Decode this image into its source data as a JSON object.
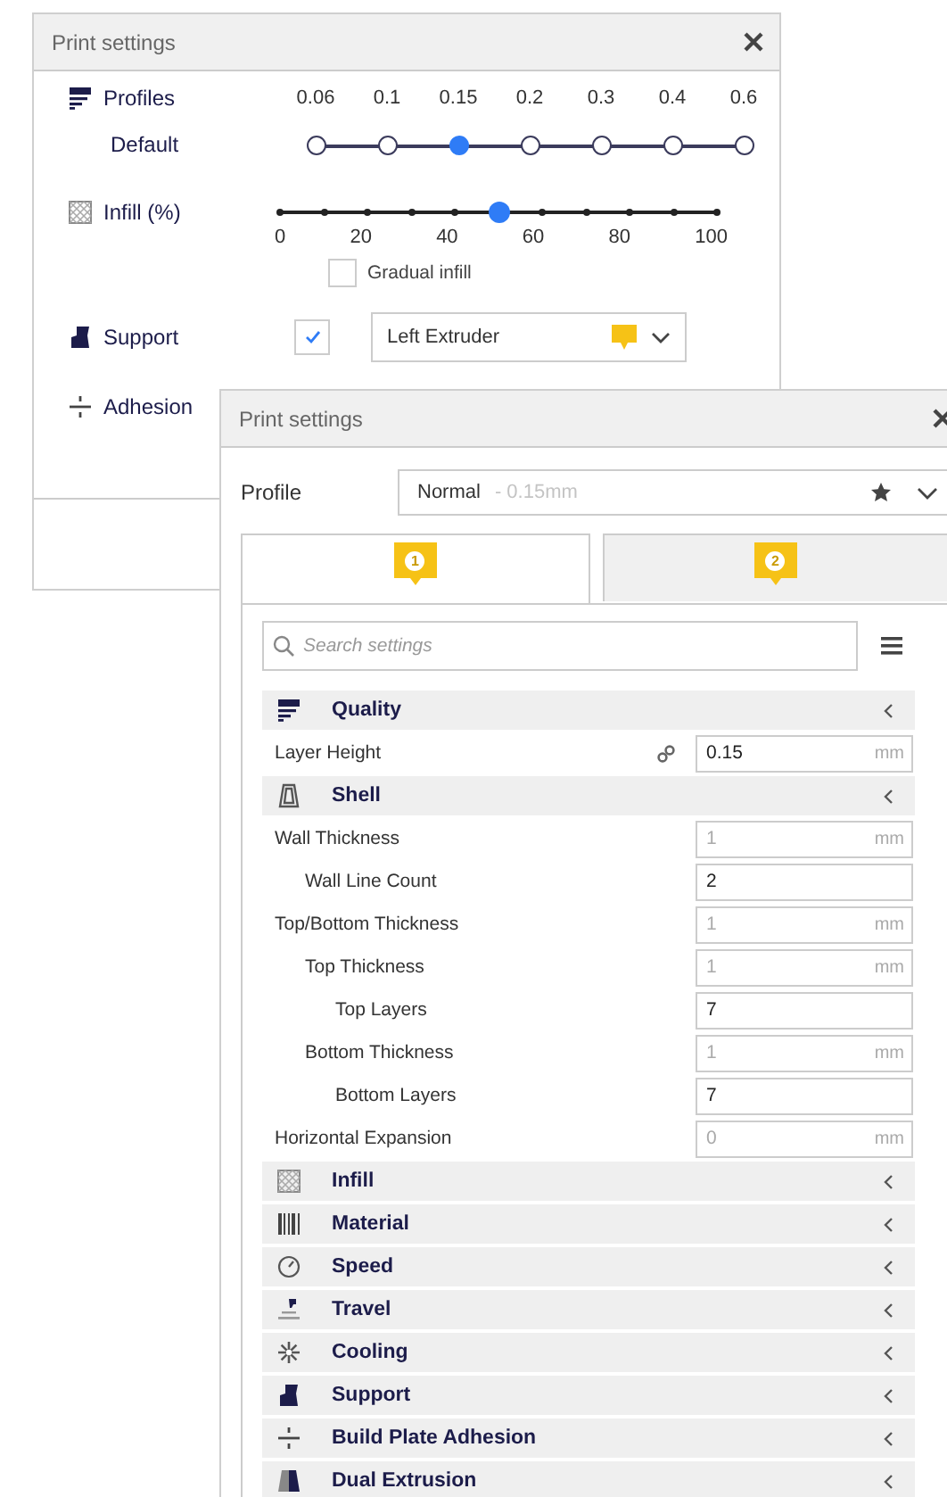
{
  "back_dialog": {
    "title": "Print settings",
    "profiles": {
      "label": "Profiles",
      "sublabel": "Default",
      "options": [
        {
          "label": "0.06",
          "selected": false
        },
        {
          "label": "0.1",
          "selected": false
        },
        {
          "label": "0.15",
          "selected": true
        },
        {
          "label": "0.2",
          "selected": false
        },
        {
          "label": "0.3",
          "selected": false
        },
        {
          "label": "0.4",
          "selected": false
        },
        {
          "label": "0.6",
          "selected": false
        }
      ]
    },
    "infill": {
      "label": "Infill (%)",
      "level": 0.5,
      "ticks": [
        "0",
        "20",
        "40",
        "60",
        "80",
        "100"
      ]
    },
    "gradual_infill": {
      "label": "Gradual infill",
      "checked": false
    },
    "support": {
      "label": "Support",
      "checked": true,
      "extruder": "Left Extruder"
    },
    "adhesion": {
      "label": "Adhesion"
    }
  },
  "front_dialog": {
    "title": "Print settings",
    "profile": {
      "label": "Profile",
      "name": "Normal",
      "detail": "- 0.15mm"
    },
    "extruder_tabs": [
      {
        "label": "1",
        "selected": true
      },
      {
        "label": "2",
        "selected": false
      }
    ],
    "search": {
      "placeholder": "Search settings"
    },
    "categories": [
      {
        "label": "Quality",
        "settings": [
          {
            "label": "Layer Height",
            "value": "0.15",
            "unit": "mm",
            "linked": true,
            "greyed": false
          }
        ]
      },
      {
        "label": "Shell",
        "settings": [
          {
            "label": "Wall Thickness",
            "value": "1",
            "unit": "mm",
            "linked": false,
            "greyed": true,
            "children": [
              {
                "label": "Wall Line Count",
                "value": "2",
                "linked": false,
                "greyed": false
              }
            ]
          },
          {
            "label": "Top/Bottom Thickness",
            "value": "1",
            "unit": "mm",
            "linked": false,
            "greyed": true,
            "children": [
              {
                "label": "Top Thickness",
                "value": "1",
                "unit": "mm",
                "linked": false,
                "greyed": true,
                "children": [
                  {
                    "label": "Top Layers",
                    "value": "7",
                    "linked": false,
                    "greyed": false
                  }
                ]
              },
              {
                "label": "Bottom Thickness",
                "value": "1",
                "unit": "mm",
                "linked": false,
                "greyed": true,
                "children": [
                  {
                    "label": "Bottom Layers",
                    "value": "7",
                    "linked": false,
                    "greyed": false
                  }
                ]
              }
            ]
          },
          {
            "label": "Horizontal Expansion",
            "value": "0",
            "unit": "mm",
            "linked": false,
            "greyed": true
          }
        ]
      },
      {
        "label": "Infill"
      },
      {
        "label": "Material"
      },
      {
        "label": "Speed"
      },
      {
        "label": "Travel"
      },
      {
        "label": "Cooling"
      },
      {
        "label": "Support"
      },
      {
        "label": "Build Plate Adhesion"
      },
      {
        "label": "Dual Extrusion"
      }
    ]
  }
}
